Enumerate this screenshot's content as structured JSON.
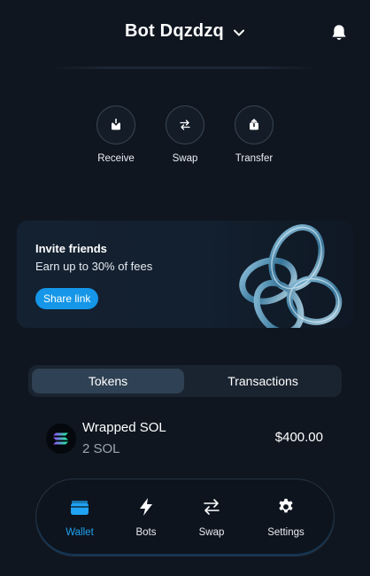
{
  "header": {
    "account_name": "Bot Dqzdzq"
  },
  "actions": [
    {
      "label": "Receive",
      "icon": "receive-icon"
    },
    {
      "label": "Swap",
      "icon": "swap-icon"
    },
    {
      "label": "Transfer",
      "icon": "transfer-icon"
    }
  ],
  "promo": {
    "title": "Invite friends",
    "subtitle": "Earn up to 30% of fees",
    "button_label": "Share link",
    "button_color": "#1596e8"
  },
  "tabs": [
    {
      "label": "Tokens",
      "active": true
    },
    {
      "label": "Transactions",
      "active": false
    }
  ],
  "tokens": [
    {
      "name": "Wrapped SOL",
      "amount": "2 SOL",
      "value": "$400.00",
      "icon": "solana-icon"
    }
  ],
  "bottom_nav": [
    {
      "label": "Wallet",
      "icon": "wallet-icon",
      "active": true
    },
    {
      "label": "Bots",
      "icon": "bolt-icon",
      "active": false
    },
    {
      "label": "Swap",
      "icon": "swap-icon",
      "active": false
    },
    {
      "label": "Settings",
      "icon": "gear-icon",
      "active": false
    }
  ],
  "colors": {
    "background": "#0f1620",
    "accent": "#1fa3f2"
  }
}
